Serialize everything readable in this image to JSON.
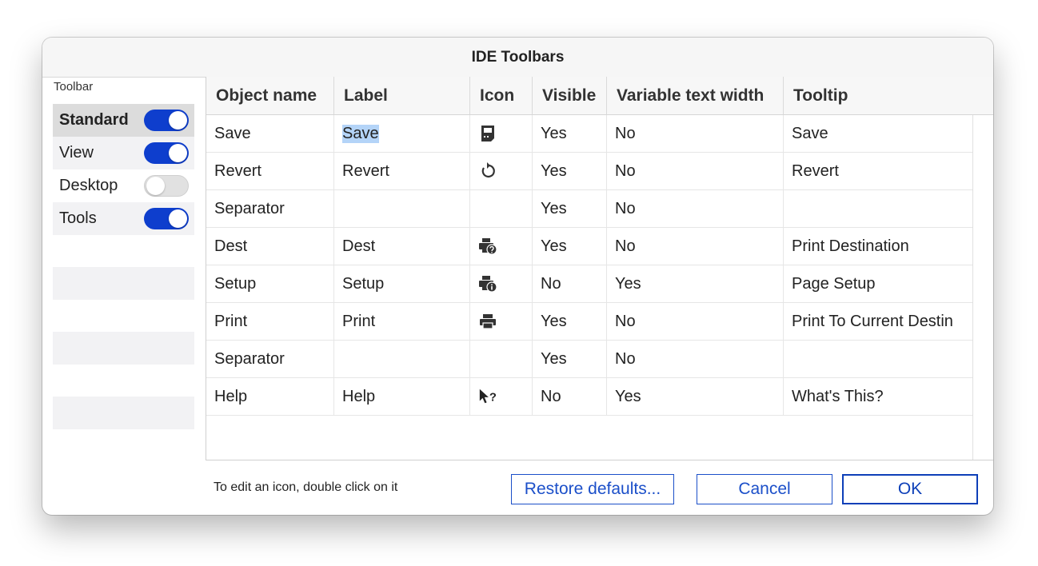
{
  "window": {
    "title": "IDE Toolbars"
  },
  "toolbar_panel": {
    "label": "Toolbar",
    "items": [
      {
        "name": "Standard",
        "enabled": true,
        "selected": true
      },
      {
        "name": "View",
        "enabled": true,
        "selected": false
      },
      {
        "name": "Desktop",
        "enabled": false,
        "selected": false
      },
      {
        "name": "Tools",
        "enabled": true,
        "selected": false
      }
    ]
  },
  "table": {
    "headers": [
      "Object name",
      "Label",
      "Icon",
      "Visible",
      "Variable text width",
      "Tooltip"
    ],
    "rows": [
      {
        "object_name": "Save",
        "label": "Save",
        "icon": "save-icon",
        "visible": "Yes",
        "variable_width": "No",
        "tooltip": "Save"
      },
      {
        "object_name": "Revert",
        "label": "Revert",
        "icon": "revert-icon",
        "visible": "Yes",
        "variable_width": "No",
        "tooltip": "Revert"
      },
      {
        "object_name": "Separator",
        "label": "",
        "icon": "",
        "visible": "Yes",
        "variable_width": "No",
        "tooltip": ""
      },
      {
        "object_name": "Dest",
        "label": "Dest",
        "icon": "print-destination-icon",
        "visible": "Yes",
        "variable_width": "No",
        "tooltip": "Print Destination"
      },
      {
        "object_name": "Setup",
        "label": "Setup",
        "icon": "page-setup-icon",
        "visible": "No",
        "variable_width": "Yes",
        "tooltip": "Page Setup"
      },
      {
        "object_name": "Print",
        "label": "Print",
        "icon": "printer-icon",
        "visible": "Yes",
        "variable_width": "No",
        "tooltip": "Print To Current Destin"
      },
      {
        "object_name": "Separator",
        "label": "",
        "icon": "",
        "visible": "Yes",
        "variable_width": "No",
        "tooltip": ""
      },
      {
        "object_name": "Help",
        "label": "Help",
        "icon": "whats-this-icon",
        "visible": "No",
        "variable_width": "Yes",
        "tooltip": "What's This?"
      }
    ]
  },
  "footer": {
    "hint": "To edit an icon, double click on it",
    "restore_label": "Restore defaults...",
    "cancel_label": "Cancel",
    "ok_label": "OK"
  },
  "colors": {
    "toggle_on": "#0e3ecd",
    "toggle_off": "#e1e1e1",
    "button_border": "#1b4fc9",
    "text_selection": "#b4d4f8"
  }
}
